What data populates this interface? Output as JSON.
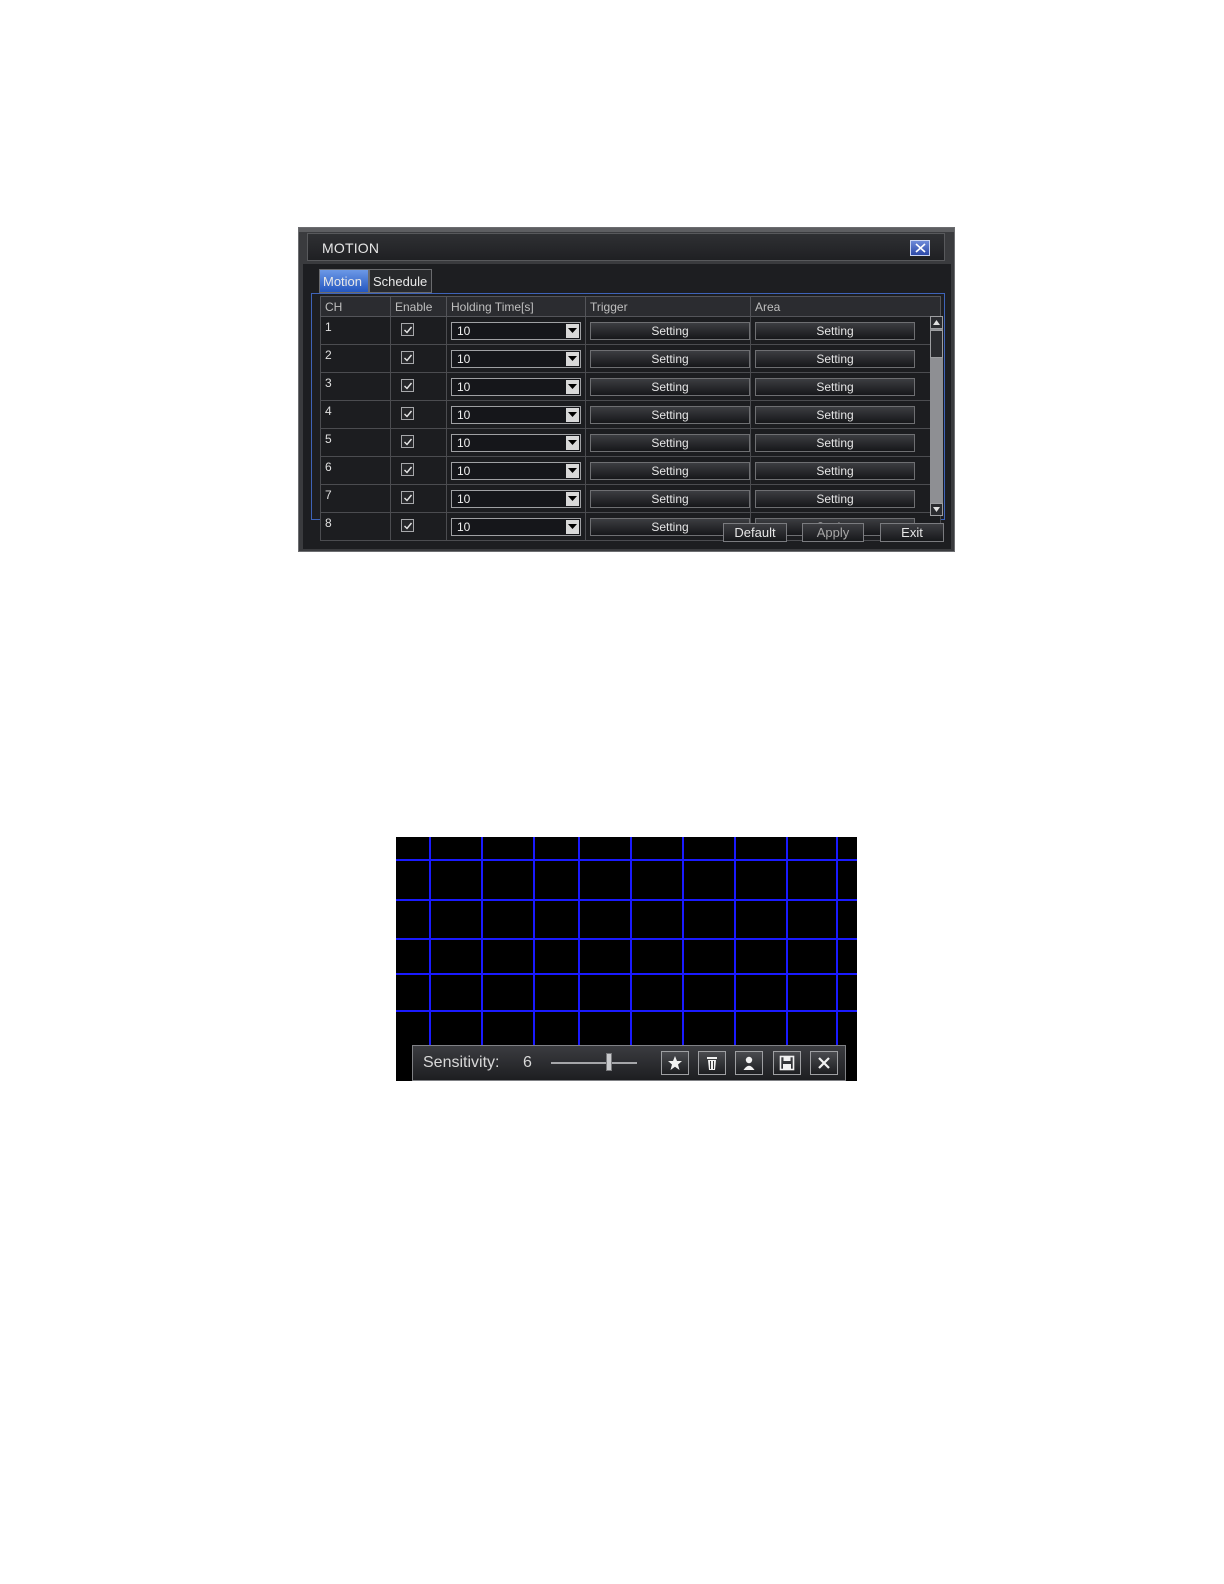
{
  "motion_window": {
    "title": "MOTION",
    "tabs": [
      {
        "label": "Motion",
        "active": true
      },
      {
        "label": "Schedule",
        "active": false
      }
    ],
    "table": {
      "headers": [
        "CH",
        "Enable",
        "Holding Time[s]",
        "Trigger",
        "Area"
      ],
      "rows": [
        {
          "ch": "1",
          "holding": "10",
          "trigger": "Setting",
          "area": "Setting"
        },
        {
          "ch": "2",
          "holding": "10",
          "trigger": "Setting",
          "area": "Setting"
        },
        {
          "ch": "3",
          "holding": "10",
          "trigger": "Setting",
          "area": "Setting"
        },
        {
          "ch": "4",
          "holding": "10",
          "trigger": "Setting",
          "area": "Setting"
        },
        {
          "ch": "5",
          "holding": "10",
          "trigger": "Setting",
          "area": "Setting"
        },
        {
          "ch": "6",
          "holding": "10",
          "trigger": "Setting",
          "area": "Setting"
        },
        {
          "ch": "7",
          "holding": "10",
          "trigger": "Setting",
          "area": "Setting"
        },
        {
          "ch": "8",
          "holding": "10",
          "trigger": "Setting",
          "area": "Setting"
        }
      ]
    },
    "buttons": {
      "default": "Default",
      "apply": "Apply",
      "exit": "Exit"
    }
  },
  "area_editor": {
    "sensitivity_label": "Sensitivity:",
    "sensitivity_value": "6",
    "tools": [
      "star-icon",
      "trash-icon",
      "person-icon",
      "save-icon",
      "close-icon"
    ],
    "grid_color": "#1a1aff"
  }
}
